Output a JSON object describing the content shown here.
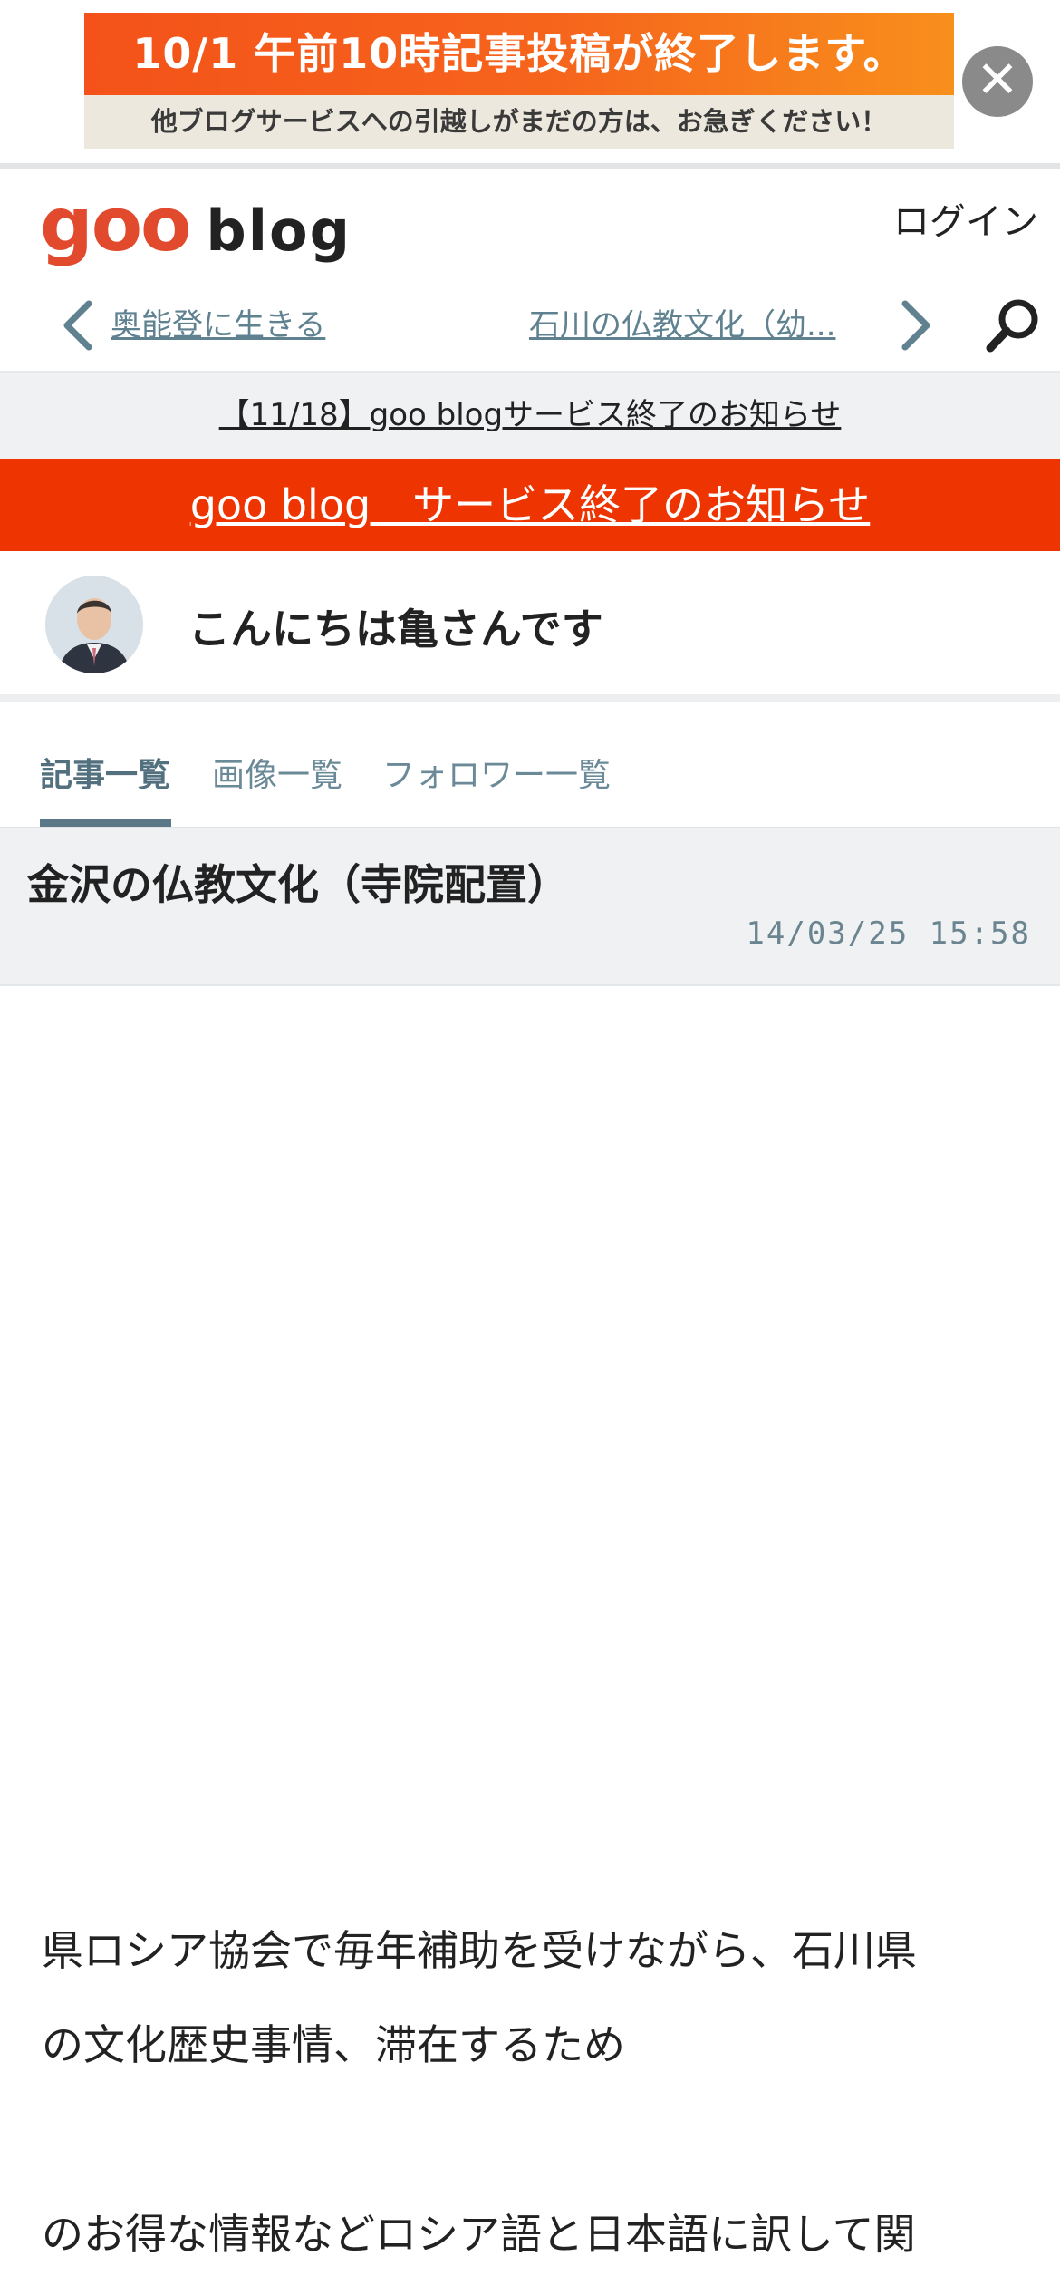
{
  "ad": {
    "headline": "10/1 午前10時記事投稿が終了します。",
    "subline": "他ブログサービスへの引越しがまだの方は、お急ぎください！",
    "close_glyph": "✕"
  },
  "header": {
    "logo_brand": "goo",
    "logo_suffix": "blog",
    "login": "ログイン"
  },
  "article_nav": {
    "prev": "奥能登に生きる",
    "next": "石川の仏教文化（幼..."
  },
  "notice": {
    "text": "【11/18】goo blogサービス終了のお知らせ"
  },
  "service_banner": {
    "text": "goo blog　サービス終了のお知らせ",
    "color": "#ee3400"
  },
  "profile": {
    "blog_title": "こんにちは亀さんです"
  },
  "tabs": [
    {
      "label": "記事一覧",
      "active": true
    },
    {
      "label": "画像一覧",
      "active": false
    },
    {
      "label": "フォロワー一覧",
      "active": false
    }
  ],
  "post": {
    "title": "金沢の仏教文化（寺院配置）",
    "date": "14/03/25 15:58",
    "paragraph1_line1": "県ロシア協会で毎年補助を受けながら、石川県",
    "paragraph1_line2": "の文化歴史事情、滞在するため",
    "paragraph2_line1": "のお得な情報などロシア語と日本語に訳して関"
  },
  "icons": {
    "prev": "chevron-left-icon",
    "next": "chevron-right-icon",
    "search": "search-icon",
    "close": "close-icon"
  }
}
